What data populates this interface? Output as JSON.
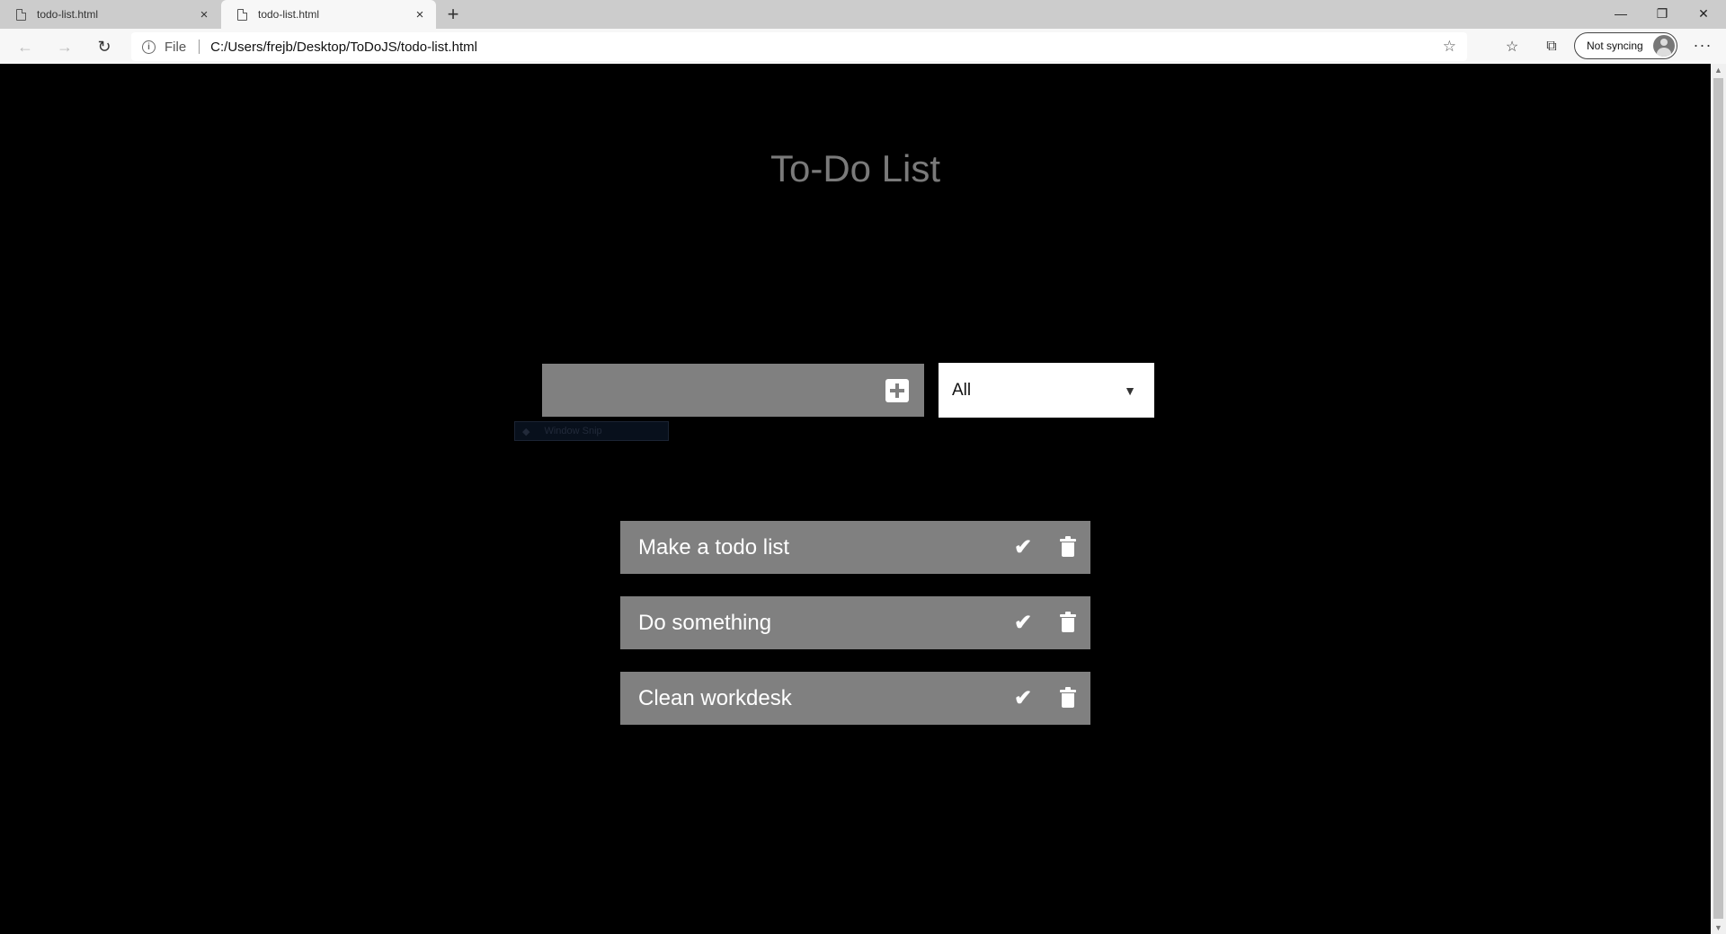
{
  "browser": {
    "tabs": [
      {
        "title": "todo-list.html",
        "close": "×"
      },
      {
        "title": "todo-list.html",
        "close": "×"
      }
    ],
    "new_tab": "+",
    "window": {
      "minimize": "—",
      "maximize": "❐",
      "close": "✕"
    },
    "nav": {
      "back": "←",
      "forward": "→",
      "refresh": "↻"
    },
    "address": {
      "info": "i",
      "scheme": "File",
      "url": "C:/Users/frejb/Desktop/ToDoJS/todo-list.html",
      "favorite": "☆"
    },
    "toolbar_icons": {
      "favorites": "☆",
      "collections": "⧉"
    },
    "profile": {
      "label": "Not syncing"
    },
    "more": "···"
  },
  "app": {
    "title": "To-Do List",
    "input": {
      "value": "",
      "placeholder": ""
    },
    "filter": {
      "selected": "All",
      "arrow": "▼"
    },
    "snip_overlay": {
      "label": "Window Snip",
      "dot": "◆"
    },
    "todos": [
      {
        "text": "Make a todo list"
      },
      {
        "text": "Do something"
      },
      {
        "text": "Clean workdesk"
      }
    ],
    "check_glyph": "✔"
  },
  "scrollbar": {
    "up": "▲",
    "down": "▼"
  }
}
